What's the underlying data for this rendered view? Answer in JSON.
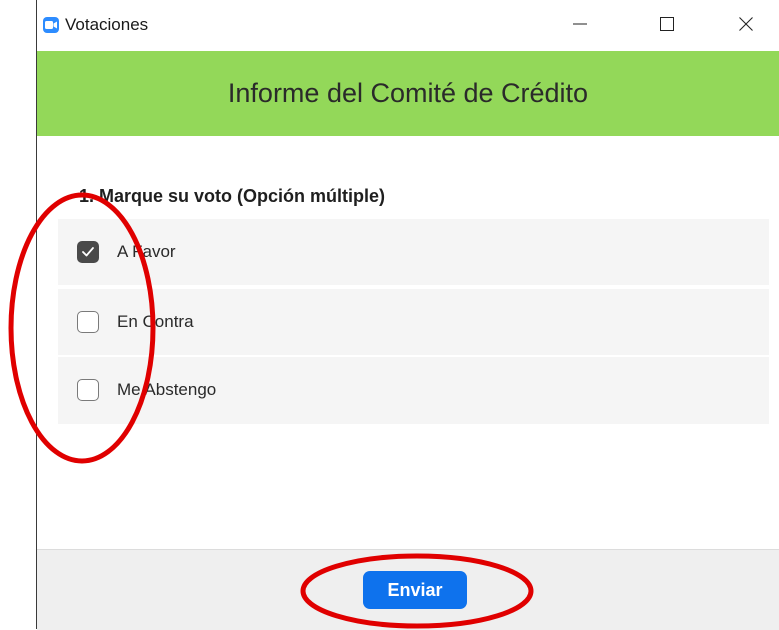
{
  "window": {
    "title": "Votaciones",
    "controls": {
      "minimize_icon": "minimize-icon",
      "maximize_icon": "maximize-icon",
      "close_icon": "close-icon"
    }
  },
  "poll": {
    "header_title": "Informe del Comité de Crédito",
    "question": "1. Marque su voto (Opción múltiple)",
    "options": [
      {
        "label": "A Favor",
        "checked": true
      },
      {
        "label": "En Contra",
        "checked": false
      },
      {
        "label": "Me Abstengo",
        "checked": false
      }
    ],
    "submit_label": "Enviar"
  },
  "colors": {
    "header_bg": "#93d859",
    "submit_bg": "#0e72ed",
    "annotation": "#e00000",
    "app_icon": "#2d8cff"
  }
}
